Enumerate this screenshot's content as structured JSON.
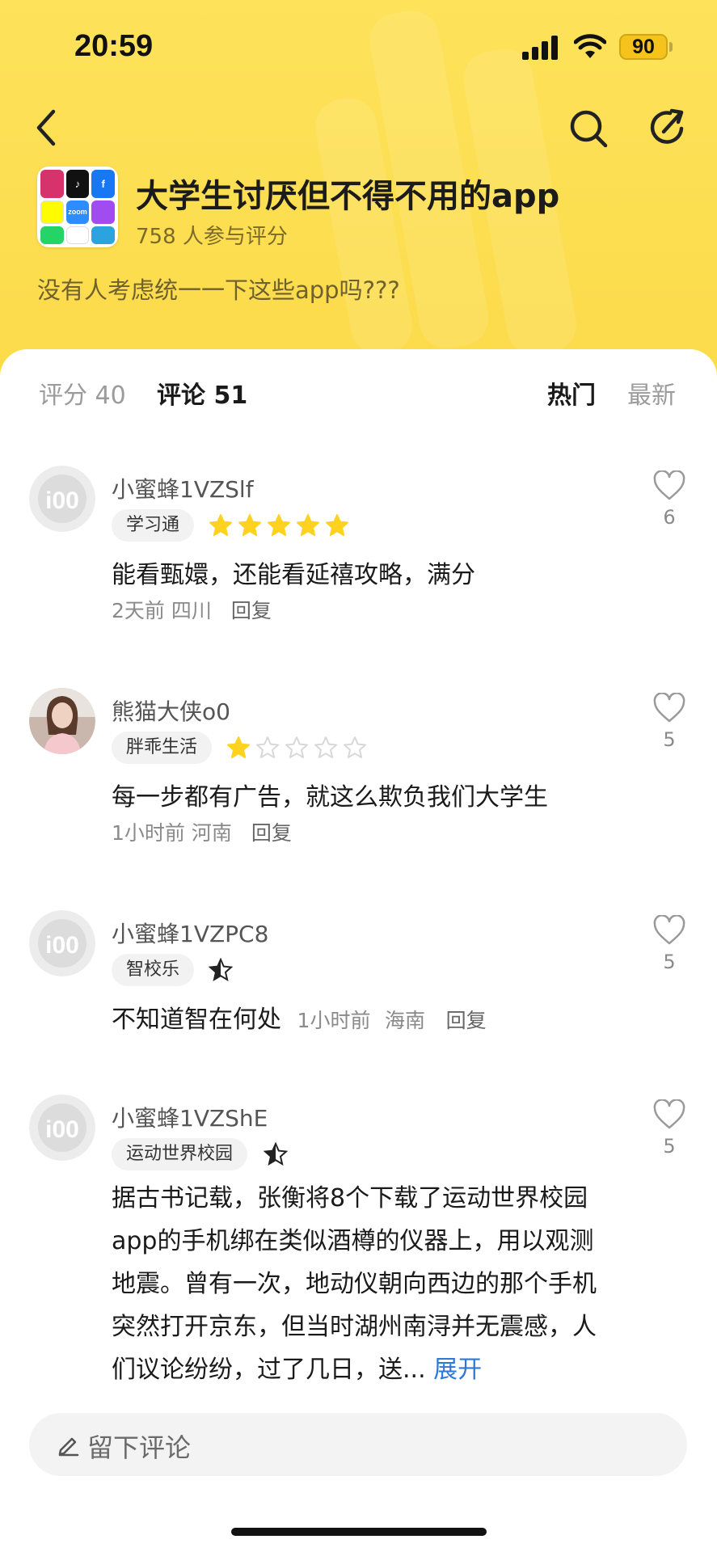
{
  "status": {
    "time": "20:59",
    "battery": "90"
  },
  "header": {
    "title": "大学生讨厌但不得不用的app",
    "participants": "758 人参与评分",
    "description": "没有人考虑统一一下这些app吗???",
    "app_tiles": [
      {
        "name": "instagram-icon",
        "label": "",
        "color": "#d6336c"
      },
      {
        "name": "tiktok-icon",
        "label": "♪",
        "color": "#111111"
      },
      {
        "name": "facebook-icon",
        "label": "f",
        "color": "#1877f2"
      },
      {
        "name": "snapchat-icon",
        "label": "",
        "color": "#fffc00"
      },
      {
        "name": "zoom-icon",
        "label": "zoom",
        "color": "#2d8cff"
      },
      {
        "name": "messenger-icon",
        "label": "",
        "color": "#a04cf0"
      },
      {
        "name": "whatsapp-icon",
        "label": "",
        "color": "#25d366"
      },
      {
        "name": "capcut-icon",
        "label": "",
        "color": "#ffffff"
      },
      {
        "name": "telegram-icon",
        "label": "",
        "color": "#2aa3df"
      }
    ]
  },
  "tabs": {
    "rating": "评分 40",
    "comments": "评论 51",
    "sort_hot": "热门",
    "sort_new": "最新"
  },
  "comments": [
    {
      "username": "小蜜蜂1VZSlf",
      "app": "学习通",
      "rating": 5,
      "text": "能看甄嬛，还能看延禧攻略，满分",
      "time": "2天前",
      "location": "四川",
      "reply": "回复",
      "likes": "6"
    },
    {
      "username": "熊猫大侠o0",
      "app": "胖乖生活",
      "rating": 1,
      "text": "每一步都有广告，就这么欺负我们大学生",
      "time": "1小时前",
      "location": "河南",
      "reply": "回复",
      "likes": "5"
    },
    {
      "username": "小蜜蜂1VZPC8",
      "app": "智校乐",
      "rating": 0.5,
      "text": "不知道智在何处",
      "time": "1小时前",
      "location": "海南",
      "reply": "回复",
      "likes": "5"
    },
    {
      "username": "小蜜蜂1VZShE",
      "app": "运动世界校园",
      "rating": 0.5,
      "text": "据古书记载，张衡将8个下载了运动世界校园app的手机绑在类似酒樽的仪器上，用以观测地震。曾有一次，地动仪朝向西边的那个手机突然打开京东，但当时湖州南浔并无震感，人们议论纷纷，过了几日，送...",
      "expand": "展开",
      "likes": "5"
    }
  ],
  "input": {
    "placeholder": "留下评论"
  },
  "colors": {
    "header": "#fcdb4a",
    "star": "#ffd21f",
    "link": "#2f79d6"
  }
}
